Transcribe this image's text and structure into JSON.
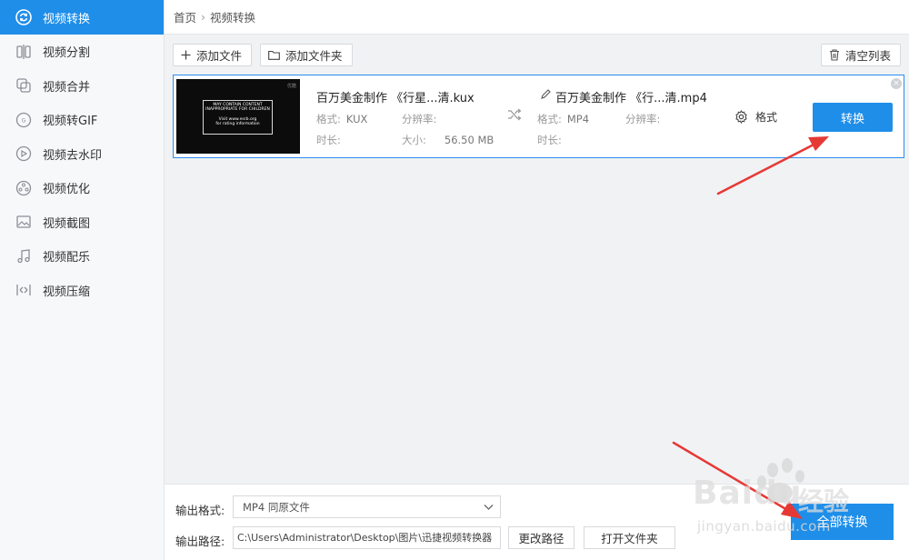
{
  "sidebar": {
    "items": [
      {
        "label": "视频转换",
        "icon": "convert-icon",
        "active": true
      },
      {
        "label": "视频分割",
        "icon": "split-icon"
      },
      {
        "label": "视频合并",
        "icon": "merge-icon"
      },
      {
        "label": "视频转GIF",
        "icon": "gif-icon"
      },
      {
        "label": "视频去水印",
        "icon": "watermark-icon"
      },
      {
        "label": "视频优化",
        "icon": "optimize-icon"
      },
      {
        "label": "视频截图",
        "icon": "screenshot-icon"
      },
      {
        "label": "视频配乐",
        "icon": "music-icon"
      },
      {
        "label": "视频压缩",
        "icon": "compress-icon"
      }
    ]
  },
  "breadcrumb": {
    "home": "首页",
    "current": "视频转换"
  },
  "toolbar": {
    "add_file": "添加文件",
    "add_folder": "添加文件夹",
    "clear_list": "清空列表"
  },
  "file": {
    "thumb_lines": [
      "MAY CONTAIN CONTENT",
      "INAPPROPRIATE FOR CHILDREN",
      "Visit www.esrb.org",
      "for rating information"
    ],
    "thumb_corner": "优酷",
    "source": {
      "name": "百万美金制作 《行星...清.kux",
      "format_label": "格式:",
      "format_value": "KUX",
      "resolution_label": "分辨率:",
      "duration_label": "时长:",
      "size_label": "大小:",
      "size_value": "56.50 MB"
    },
    "output": {
      "name": "百万美金制作 《行...清.mp4",
      "format_label": "格式:",
      "format_value": "MP4",
      "resolution_label": "分辨率:",
      "duration_label": "时长:"
    },
    "format_setting": "格式",
    "convert_label": "转换",
    "close_glyph": "×"
  },
  "bottom": {
    "format_label": "输出格式:",
    "format_value": "MP4  同原文件",
    "path_label": "输出路径:",
    "path_value": "C:\\Users\\Administrator\\Desktop\\图片\\迅捷视频转换器",
    "change_path": "更改路径",
    "open_folder": "打开文件夹",
    "convert_all": "全部转换"
  },
  "watermark": {
    "brand": "Baidu",
    "brand_cn": "经验",
    "sub": "jingyan.baidu.com"
  },
  "colors": {
    "accent": "#1f8ee9",
    "arrow": "#e53935"
  }
}
